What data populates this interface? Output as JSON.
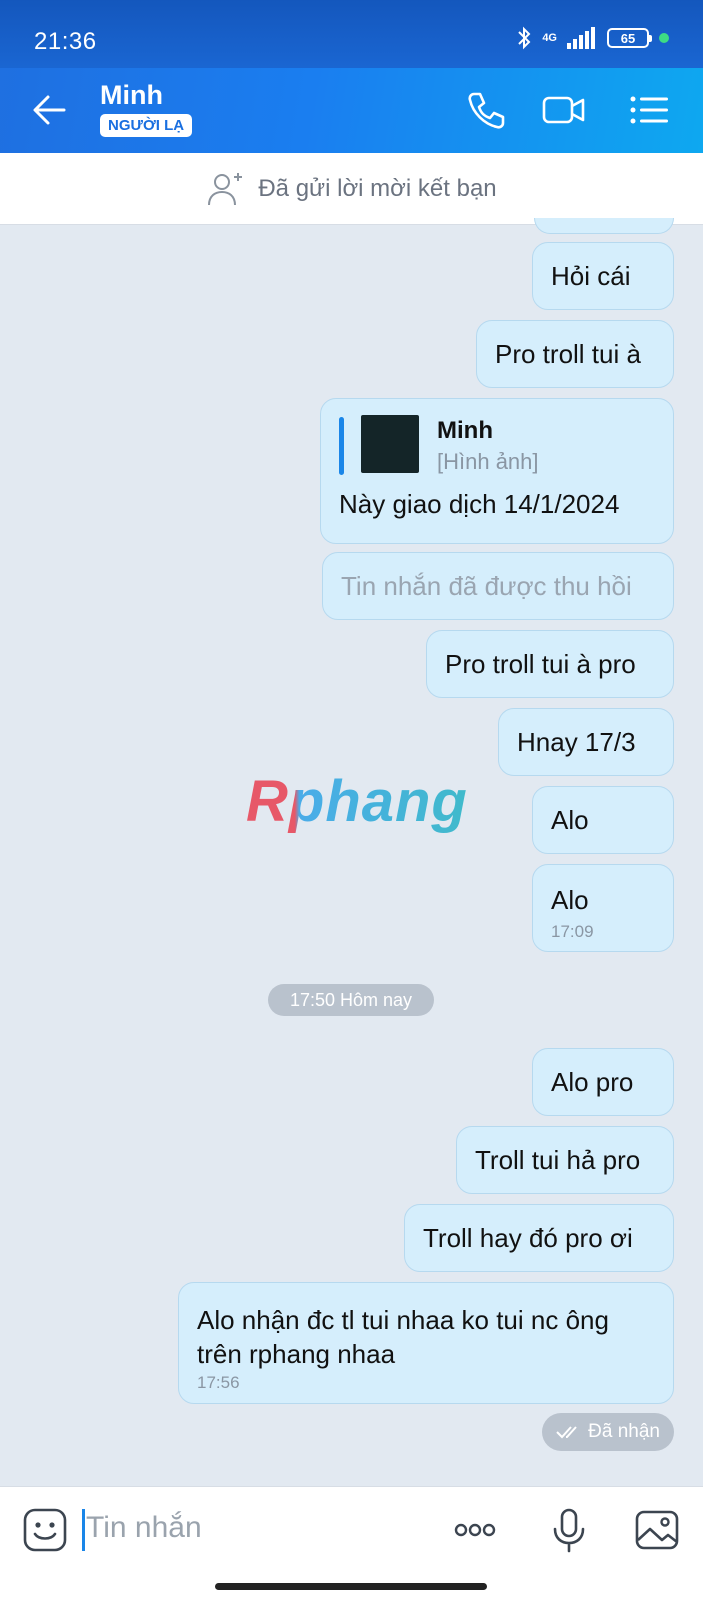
{
  "status_bar": {
    "time": "21:36",
    "network": "4G",
    "battery": "65"
  },
  "header": {
    "contact_name": "Minh",
    "stranger_badge": "NGƯỜI LẠ"
  },
  "friend_bar": {
    "text": "Đã gửi lời mời kết bạn"
  },
  "messages": [
    {
      "text": "Hỏi cái"
    },
    {
      "text": "Pro troll tui à"
    },
    {
      "quote_name": "Minh",
      "quote_sub": "[Hình ảnh]",
      "text": "Này giao dịch 14/1/2024"
    },
    {
      "text": "Tin nhắn đã được thu hồi",
      "recalled": true
    },
    {
      "text": "Pro troll tui à pro"
    },
    {
      "text": "Hnay 17/3"
    },
    {
      "text": "Alo"
    },
    {
      "text": "Alo",
      "time": "17:09"
    },
    {
      "text": "Alo pro"
    },
    {
      "text": "Troll tui hả pro"
    },
    {
      "text": "Troll hay đó pro ơi"
    },
    {
      "text": "Alo nhận đc tl tui nhaa ko tui nc ông trên rphang nhaa",
      "time": "17:56"
    }
  ],
  "day_separator": "17:50 Hôm nay",
  "received_label": "Đã nhận",
  "watermark": "Rphang",
  "input": {
    "placeholder": "Tin nhắn"
  },
  "colors": {
    "accent": "#1a86e8",
    "bubble": "#d5eefc",
    "background": "#e2e9f1"
  }
}
